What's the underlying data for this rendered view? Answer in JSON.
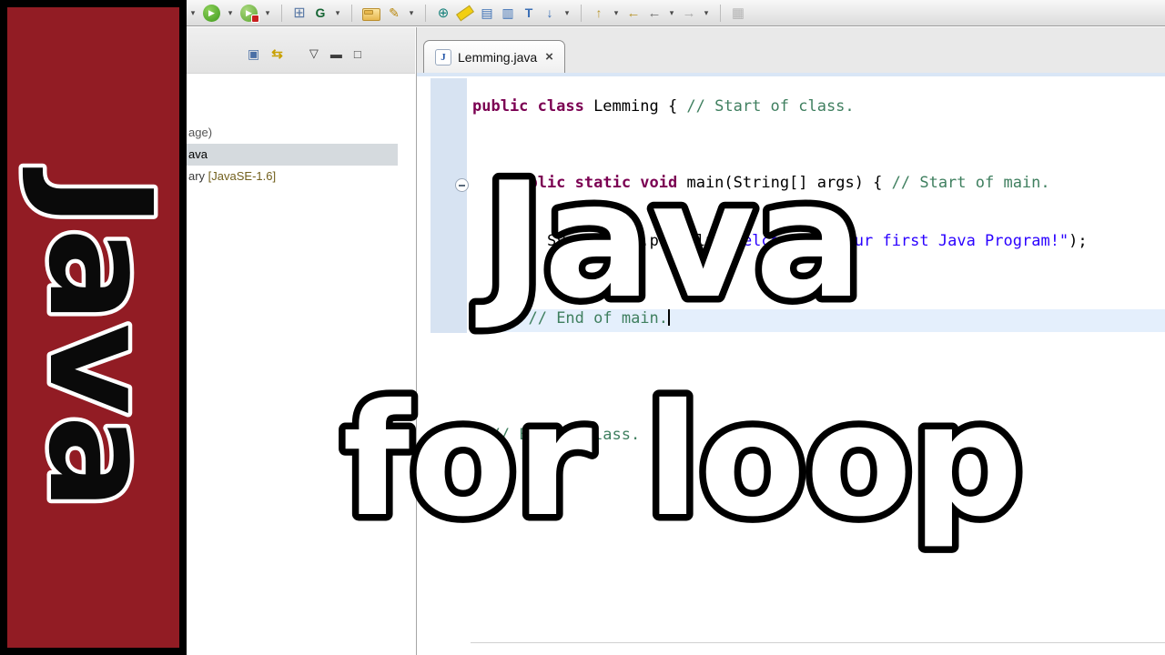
{
  "banner": {
    "word": "Java",
    "bg": "#921c24"
  },
  "overlays": {
    "line1": "Java",
    "line2": "for loop"
  },
  "toolbar": {
    "icons": [
      {
        "name": "run-dropdown-caret",
        "glyph": "▾",
        "cls": "c-caret"
      },
      {
        "name": "run-icon",
        "glyph": "▶",
        "cls": "c-run"
      },
      {
        "name": "run-config-caret",
        "glyph": "▾",
        "cls": "c-caret"
      },
      {
        "name": "debug-icon",
        "glyph": "▶",
        "cls": "c-debug"
      },
      {
        "name": "debug-config-caret",
        "glyph": "▾",
        "cls": "c-caret"
      },
      {
        "name": "separator"
      },
      {
        "name": "new-project-grid-icon",
        "glyph": "⊞",
        "cls": "c-grid"
      },
      {
        "name": "open-type-icon",
        "glyph": "G",
        "cls": "c-g"
      },
      {
        "name": "open-type-caret",
        "glyph": "▾",
        "cls": "c-caret"
      },
      {
        "name": "separator"
      },
      {
        "name": "open-folder-icon",
        "glyph": "",
        "cls": "c-folder"
      },
      {
        "name": "magic-wand-icon",
        "glyph": "✎",
        "cls": "c-wand"
      },
      {
        "name": "wand-caret",
        "glyph": "▾",
        "cls": "c-caret"
      },
      {
        "name": "separator"
      },
      {
        "name": "globe-icon",
        "glyph": "⊕",
        "cls": "c-globe"
      },
      {
        "name": "highlighter-icon",
        "glyph": "",
        "cls": "c-hl"
      },
      {
        "name": "javadoc-icon",
        "glyph": "▤",
        "cls": "c-book"
      },
      {
        "name": "declaration-icon",
        "glyph": "▥",
        "cls": "c-book"
      },
      {
        "name": "type-indicator-icon",
        "glyph": "T",
        "cls": "c-type"
      },
      {
        "name": "pulldown-icon",
        "glyph": "↓",
        "cls": "c-down"
      },
      {
        "name": "pulldown-caret",
        "glyph": "▾",
        "cls": "c-caret"
      },
      {
        "name": "separator"
      },
      {
        "name": "last-edit-icon",
        "glyph": "↑",
        "cls": "c-up"
      },
      {
        "name": "last-edit-caret",
        "glyph": "▾",
        "cls": "c-caret"
      },
      {
        "name": "back-to-edit-icon",
        "glyph": "←",
        "cls": "c-goldarrow"
      },
      {
        "name": "back-icon",
        "glyph": "←",
        "cls": "c-back"
      },
      {
        "name": "back-caret",
        "glyph": "▾",
        "cls": "c-caret"
      },
      {
        "name": "forward-icon",
        "glyph": "→",
        "cls": "c-fwd"
      },
      {
        "name": "forward-caret",
        "glyph": "▾",
        "cls": "c-caret"
      },
      {
        "name": "separator"
      },
      {
        "name": "image-icon",
        "glyph": "▦",
        "cls": "c-img"
      }
    ]
  },
  "explorer": {
    "tools": [
      {
        "name": "focus-icon",
        "glyph": "▣",
        "cls": "xt-blue"
      },
      {
        "name": "collapse-all-icon",
        "glyph": "⇆",
        "cls": "xt-gold"
      },
      {
        "name": "view-menu-icon",
        "glyph": "▽",
        "cls": "xt-gray xt-push"
      },
      {
        "name": "minimize-icon",
        "glyph": "▬",
        "cls": "xt-gray"
      },
      {
        "name": "maximize-icon",
        "glyph": "□",
        "cls": "xt-gray"
      }
    ],
    "items": [
      {
        "label": "age)",
        "selected": false,
        "cls": "t-pkg"
      },
      {
        "label": "ava",
        "selected": true,
        "cls": "t-file"
      },
      {
        "label": "ary",
        "suffix": " [JavaSE-1.6]",
        "selected": false,
        "cls": "t-lib"
      }
    ]
  },
  "editor": {
    "tab": {
      "icon": "J",
      "label": "Lemming.java",
      "close": "×"
    },
    "lines": {
      "l1": {
        "kw": "public class ",
        "plain": "Lemming { ",
        "comment": "// Start of class."
      },
      "l2": {
        "kw": "public static void ",
        "plain": "main(String[] args) { ",
        "comment": "// Start of main."
      },
      "l3": {
        "plain": "System.out.println(",
        "str": "\"Welcome to your first Java Program!\"",
        "plain2": ");"
      },
      "l4": {
        "plain": "} ",
        "comment": "// End of main."
      },
      "l5": {
        "plain": "} ",
        "comment": "// End of class."
      }
    }
  }
}
